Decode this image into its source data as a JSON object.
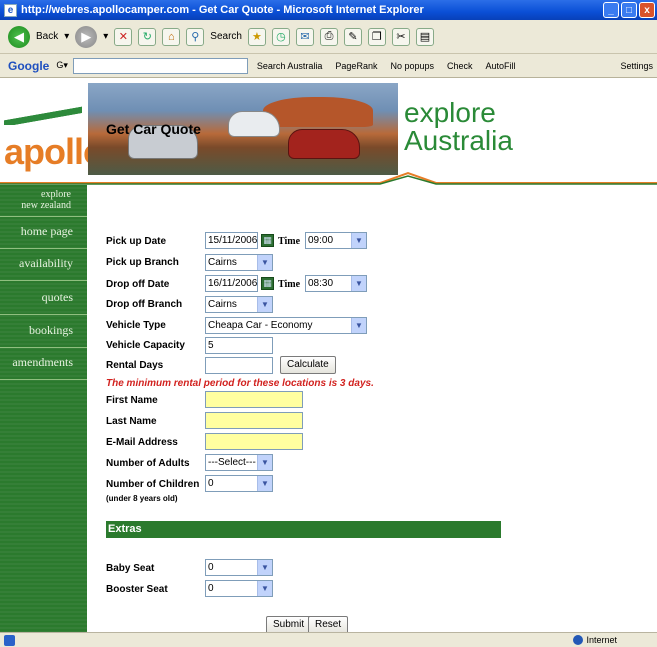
{
  "window": {
    "title": "http://webres.apollocamper.com - Get Car Quote - Microsoft Internet Explorer",
    "minimize": "_",
    "maximize": "□",
    "close": "x"
  },
  "toolbar": {
    "back_label": "Back",
    "search_label": "Search"
  },
  "googlebar": {
    "logo": "Google",
    "search_australia": "Search Australia",
    "pagerank": "PageRank",
    "no_popups": "No popups",
    "check": "Check",
    "autofill": "AutoFill",
    "settings": "Settings"
  },
  "brand": {
    "logo": "apollo",
    "tagline_line1": "explore",
    "tagline_line2": "Australia",
    "accent": "#2b7a2d",
    "orange": "#e67d26"
  },
  "sidebar": {
    "items": [
      {
        "label": "explore\nnew zealand"
      },
      {
        "label": "home page"
      },
      {
        "label": "availability"
      },
      {
        "label": "quotes"
      },
      {
        "label": "bookings"
      },
      {
        "label": "amendments"
      }
    ]
  },
  "form": {
    "heading": "Get Car Quote",
    "labels": {
      "pickup_date": "Pick up Date",
      "pickup_branch": "Pick up Branch",
      "dropoff_date": "Drop off Date",
      "dropoff_branch": "Drop off Branch",
      "vehicle_type": "Vehicle Type",
      "vehicle_capacity": "Vehicle Capacity",
      "rental_days": "Rental Days",
      "first_name": "First Name",
      "last_name": "Last Name",
      "email": "E-Mail Address",
      "adults": "Number of Adults",
      "children": "Number of Children",
      "children_note": "(under 8 years old)",
      "time": "Time"
    },
    "values": {
      "pickup_date": "15/11/2006",
      "pickup_time": "09:00",
      "pickup_branch": "Cairns",
      "dropoff_date": "16/11/2006",
      "dropoff_time": "08:30",
      "dropoff_branch": "Cairns",
      "vehicle_type": "Cheapa Car - Economy",
      "vehicle_capacity": "5",
      "rental_days": "",
      "adults": "---Select---",
      "children": "0"
    },
    "calculate_label": "Calculate",
    "warning": "The minimum rental period for these locations is 3 days.",
    "extras_title": "Extras",
    "extras": {
      "baby_seat_label": "Baby Seat",
      "baby_seat_value": "0",
      "booster_seat_label": "Booster Seat",
      "booster_seat_value": "0"
    },
    "submit_label": "Submit",
    "reset_label": "Reset"
  },
  "status": {
    "zone": "Internet"
  }
}
